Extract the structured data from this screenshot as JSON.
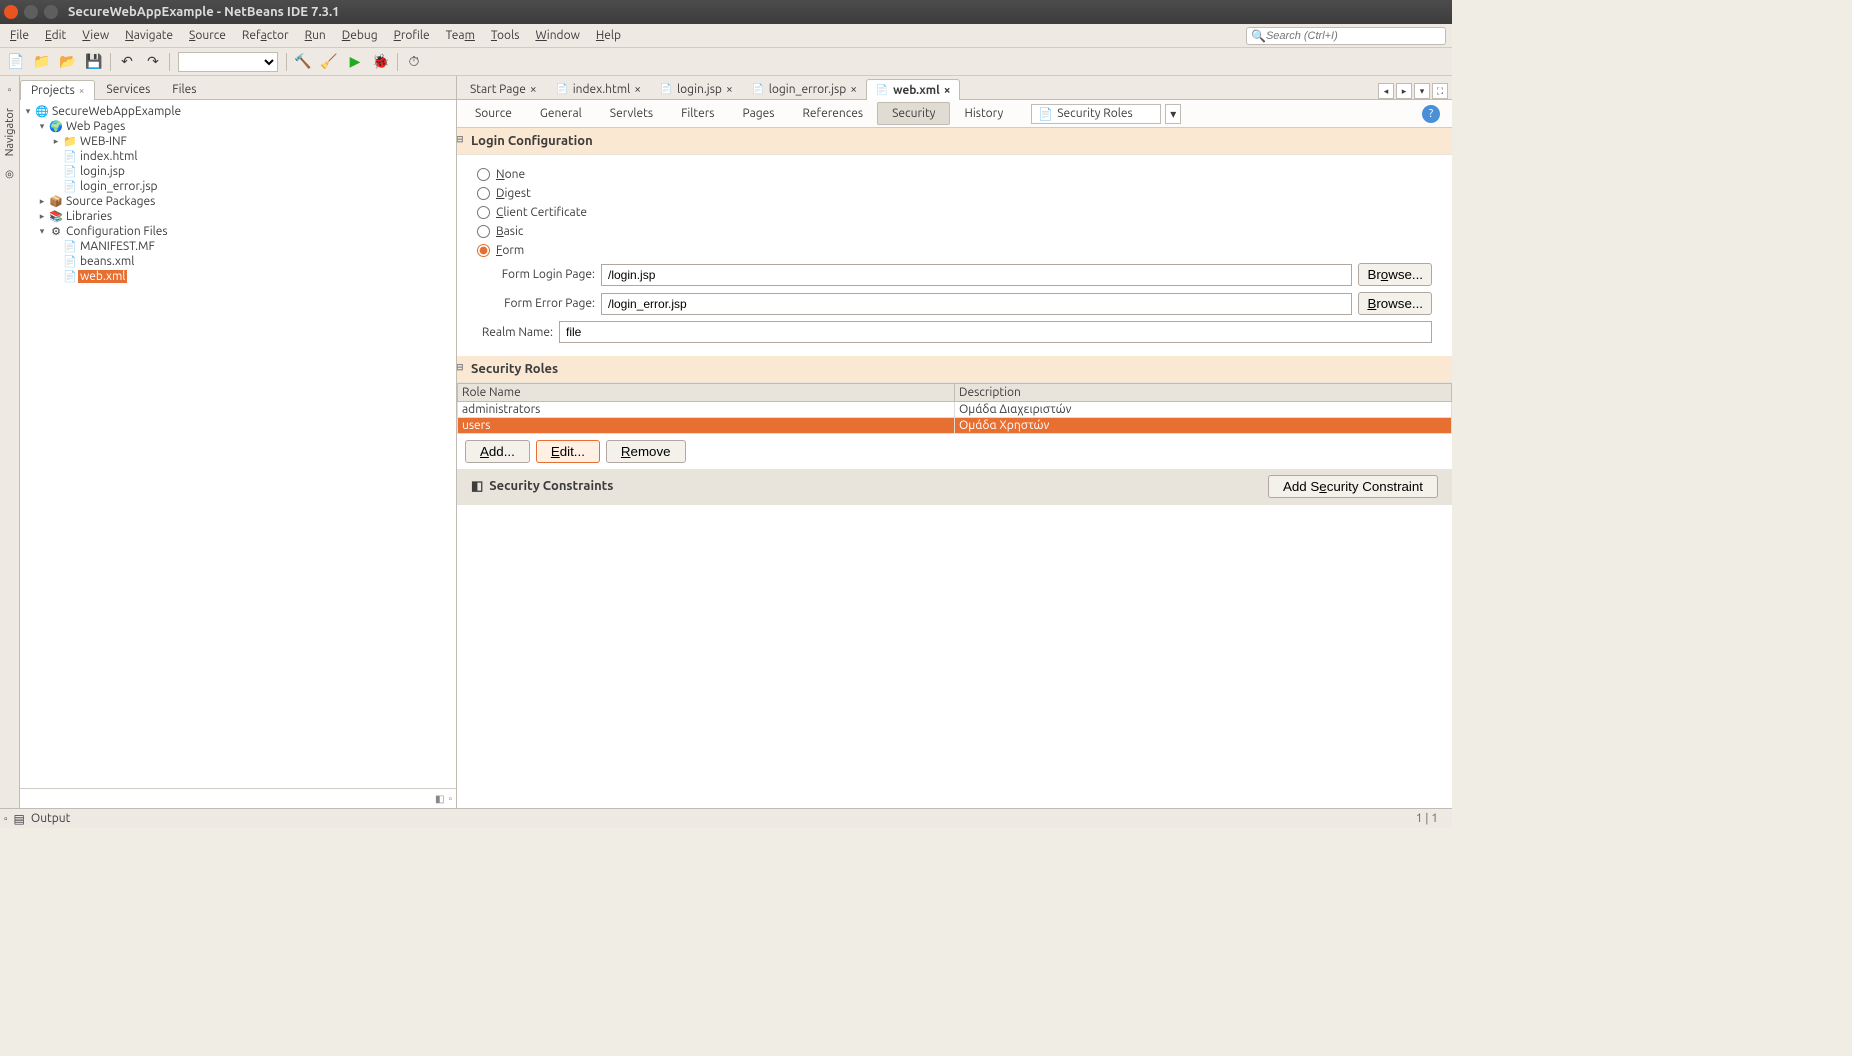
{
  "window": {
    "title": "SecureWebAppExample - NetBeans IDE 7.3.1"
  },
  "menubar": {
    "items": [
      "File",
      "Edit",
      "View",
      "Navigate",
      "Source",
      "Refactor",
      "Run",
      "Debug",
      "Profile",
      "Team",
      "Tools",
      "Window",
      "Help"
    ],
    "search_placeholder": "Search (Ctrl+I)"
  },
  "left_panel": {
    "tabs": [
      {
        "label": "Projects",
        "closable": true,
        "active": true
      },
      {
        "label": "Services",
        "closable": false,
        "active": false
      },
      {
        "label": "Files",
        "closable": false,
        "active": false
      }
    ],
    "tree": {
      "project": "SecureWebAppExample",
      "web_pages": "Web Pages",
      "web_inf": "WEB-INF",
      "index_html": "index.html",
      "login_jsp": "login.jsp",
      "login_error_jsp": "login_error.jsp",
      "source_packages": "Source Packages",
      "libraries": "Libraries",
      "config_files": "Configuration Files",
      "manifest": "MANIFEST.MF",
      "beans": "beans.xml",
      "web_xml": "web.xml"
    }
  },
  "left_gutter": {
    "navigator": "Navigator"
  },
  "editor": {
    "tabs": [
      {
        "label": "Start Page",
        "active": false
      },
      {
        "label": "index.html",
        "active": false
      },
      {
        "label": "login.jsp",
        "active": false
      },
      {
        "label": "login_error.jsp",
        "active": false
      },
      {
        "label": "web.xml",
        "active": true
      }
    ],
    "sub_tabs": [
      "Source",
      "General",
      "Servlets",
      "Filters",
      "Pages",
      "References",
      "Security",
      "History"
    ],
    "sub_tab_active": "Security",
    "combo_label": "Security Roles"
  },
  "login_config": {
    "heading": "Login Configuration",
    "options": {
      "none": "None",
      "digest": "Digest",
      "client_cert": "Client Certificate",
      "basic": "Basic",
      "form": "Form"
    },
    "form_login_label": "Form Login Page:",
    "form_login_value": "/login.jsp",
    "form_error_label": "Form Error Page:",
    "form_error_value": "/login_error.jsp",
    "realm_label": "Realm Name:",
    "realm_value": "file",
    "browse": "Browse..."
  },
  "security_roles": {
    "heading": "Security Roles",
    "col_rolename": "Role Name",
    "col_description": "Description",
    "rows": [
      {
        "name": "administrators",
        "desc": "Ομάδα Διαχειριστών"
      },
      {
        "name": "users",
        "desc": "Ομάδα Χρηστών"
      }
    ],
    "add": "Add...",
    "edit": "Edit...",
    "remove": "Remove"
  },
  "security_constraints": {
    "heading": "Security Constraints",
    "add_btn": "Add Security Constraint"
  },
  "bottom": {
    "output": "Output",
    "status": "1 | 1"
  }
}
